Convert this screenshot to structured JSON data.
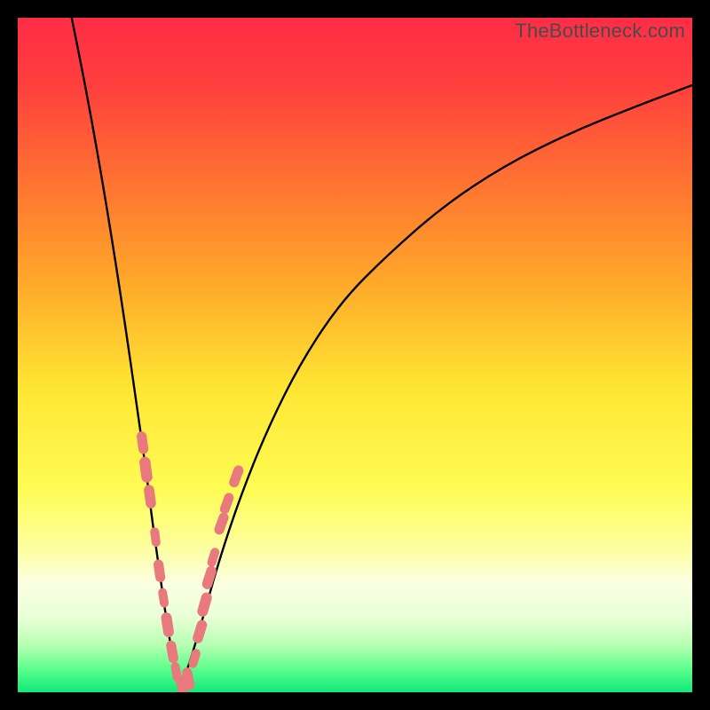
{
  "watermark": "TheBottleneck.com",
  "colors": {
    "black": "#000000",
    "curve": "#000000",
    "marker_fill": "#e87a7d",
    "marker_stroke": "#d96163",
    "gradient_stops": [
      {
        "offset": 0.0,
        "color": "#ff2d47"
      },
      {
        "offset": 0.1,
        "color": "#ff3f3d"
      },
      {
        "offset": 0.25,
        "color": "#ff7531"
      },
      {
        "offset": 0.4,
        "color": "#ffab2a"
      },
      {
        "offset": 0.55,
        "color": "#ffe633"
      },
      {
        "offset": 0.7,
        "color": "#fffc55"
      },
      {
        "offset": 0.79,
        "color": "#fdffa4"
      },
      {
        "offset": 0.84,
        "color": "#fbffe3"
      },
      {
        "offset": 0.89,
        "color": "#e8ffd6"
      },
      {
        "offset": 0.93,
        "color": "#b7ffb2"
      },
      {
        "offset": 0.965,
        "color": "#5dff8d"
      },
      {
        "offset": 1.0,
        "color": "#10e879"
      }
    ]
  },
  "chart_data": {
    "type": "line",
    "title": "",
    "xlabel": "",
    "ylabel": "",
    "xlim": [
      0,
      100
    ],
    "ylim": [
      0,
      100
    ],
    "bottleneck_minimum_x": 24,
    "description": "V-shaped bottleneck curve: value descends sharply from top-left, reaches minimum near x≈24 at y≈0, then rises asymptotically toward the upper-right.",
    "series": [
      {
        "name": "left-branch",
        "x": [
          8,
          10,
          12,
          14,
          16,
          18,
          19,
          20,
          21,
          22,
          23,
          24
        ],
        "y": [
          100,
          90,
          79,
          67,
          54,
          40,
          33,
          25,
          18,
          11,
          5,
          0
        ]
      },
      {
        "name": "right-branch",
        "x": [
          24,
          26,
          28,
          30,
          33,
          37,
          42,
          48,
          55,
          63,
          72,
          82,
          92,
          100
        ],
        "y": [
          0,
          6,
          13,
          20,
          29,
          39,
          49,
          58,
          65,
          72,
          78,
          83,
          87,
          90
        ]
      }
    ],
    "markers": {
      "name": "highlighted-points",
      "color": "#e87a7d",
      "points": [
        {
          "x": 18.5,
          "y": 37,
          "r": 1.3
        },
        {
          "x": 19.0,
          "y": 33,
          "r": 1.6
        },
        {
          "x": 19.6,
          "y": 29,
          "r": 1.4
        },
        {
          "x": 20.4,
          "y": 23,
          "r": 1.0
        },
        {
          "x": 21.0,
          "y": 18,
          "r": 1.3
        },
        {
          "x": 21.6,
          "y": 14,
          "r": 1.0
        },
        {
          "x": 22.2,
          "y": 10,
          "r": 1.5
        },
        {
          "x": 22.9,
          "y": 6,
          "r": 1.3
        },
        {
          "x": 23.5,
          "y": 3,
          "r": 1.0
        },
        {
          "x": 24.3,
          "y": 1,
          "r": 1.2
        },
        {
          "x": 25.3,
          "y": 2,
          "r": 1.3
        },
        {
          "x": 26.2,
          "y": 5,
          "r": 1.0
        },
        {
          "x": 27.0,
          "y": 9,
          "r": 1.4
        },
        {
          "x": 27.7,
          "y": 13,
          "r": 1.5
        },
        {
          "x": 28.4,
          "y": 17,
          "r": 1.4
        },
        {
          "x": 29.0,
          "y": 20,
          "r": 1.0
        },
        {
          "x": 30.2,
          "y": 25,
          "r": 1.3
        },
        {
          "x": 31.0,
          "y": 28,
          "r": 1.2
        },
        {
          "x": 32.4,
          "y": 32,
          "r": 1.3
        }
      ]
    }
  }
}
